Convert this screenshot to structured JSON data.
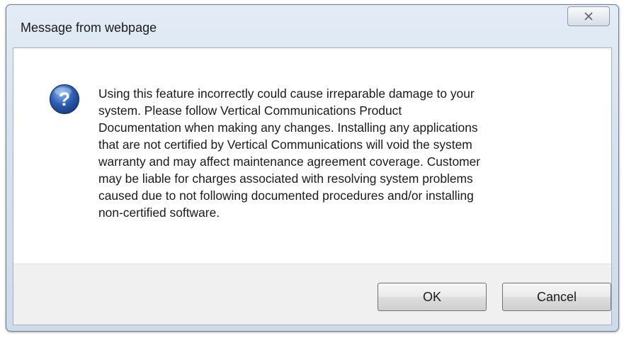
{
  "dialog": {
    "title": "Message from webpage",
    "close_icon": "close-icon",
    "message_icon": "question-icon",
    "message_lines": [
      "Using this feature incorrectly could cause irreparable damage to your",
      "system. Please follow Vertical Communications Product",
      "Documentation when making any changes. Installing any applications",
      "that are not certified by Vertical Communications will void the system",
      "warranty and may affect maintenance agreement coverage. Customer",
      "may be liable for charges associated with resolving system problems",
      "caused due to not following documented procedures and/or installing",
      "non-certified software."
    ],
    "buttons": {
      "ok": "OK",
      "cancel": "Cancel"
    }
  },
  "colors": {
    "icon_blue": "#2f5fb3",
    "frame_border": "#6e7c8d"
  }
}
